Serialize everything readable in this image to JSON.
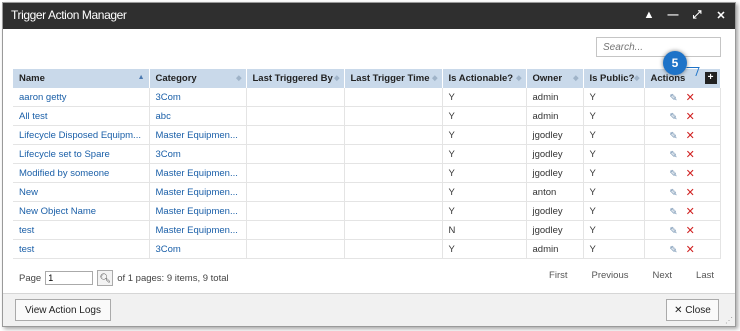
{
  "window": {
    "title": "Trigger Action Manager",
    "controls": [
      "▲",
      "—",
      "⤢",
      "✕"
    ]
  },
  "search": {
    "placeholder": "Search..."
  },
  "callout": {
    "number": "5"
  },
  "table": {
    "columns": [
      "Name",
      "Category",
      "Last Triggered By",
      "Last Trigger Time",
      "Is Actionable?",
      "Owner",
      "Is Public?",
      "Actions"
    ],
    "rows": [
      {
        "name": "aaron getty",
        "category": "3Com",
        "last_triggered_by": "",
        "last_trigger_time": "",
        "is_actionable": "Y",
        "owner": "admin",
        "is_public": "Y"
      },
      {
        "name": "All test",
        "category": "abc",
        "last_triggered_by": "",
        "last_trigger_time": "",
        "is_actionable": "Y",
        "owner": "admin",
        "is_public": "Y"
      },
      {
        "name": "Lifecycle Disposed Equipm...",
        "category": "Master Equipmen...",
        "last_triggered_by": "",
        "last_trigger_time": "",
        "is_actionable": "Y",
        "owner": "jgodley",
        "is_public": "Y"
      },
      {
        "name": "Lifecycle set to Spare",
        "category": "3Com",
        "last_triggered_by": "",
        "last_trigger_time": "",
        "is_actionable": "Y",
        "owner": "jgodley",
        "is_public": "Y"
      },
      {
        "name": "Modified by someone",
        "category": "Master Equipmen...",
        "last_triggered_by": "",
        "last_trigger_time": "",
        "is_actionable": "Y",
        "owner": "jgodley",
        "is_public": "Y"
      },
      {
        "name": "New",
        "category": "Master Equipmen...",
        "last_triggered_by": "",
        "last_trigger_time": "",
        "is_actionable": "Y",
        "owner": "anton",
        "is_public": "Y"
      },
      {
        "name": "New Object Name",
        "category": "Master Equipmen...",
        "last_triggered_by": "",
        "last_trigger_time": "",
        "is_actionable": "Y",
        "owner": "jgodley",
        "is_public": "Y"
      },
      {
        "name": "test",
        "category": "Master Equipmen...",
        "last_triggered_by": "",
        "last_trigger_time": "",
        "is_actionable": "N",
        "owner": "jgodley",
        "is_public": "Y"
      },
      {
        "name": "test",
        "category": "3Com",
        "last_triggered_by": "",
        "last_trigger_time": "",
        "is_actionable": "Y",
        "owner": "admin",
        "is_public": "Y"
      }
    ]
  },
  "pager": {
    "page_label": "Page",
    "page_value": "1",
    "summary": "of 1 pages: 9 items, 9 total",
    "first": "First",
    "previous": "Previous",
    "next": "Next",
    "last": "Last"
  },
  "footer": {
    "view_logs_label": "View Action Logs",
    "close_label": "✕ Close"
  },
  "colors": {
    "titlebar": "#2f2f2f",
    "header_bg": "#c9d9ea",
    "link": "#1a5fa8",
    "delete": "#d02020",
    "badge": "#1e73c8"
  }
}
